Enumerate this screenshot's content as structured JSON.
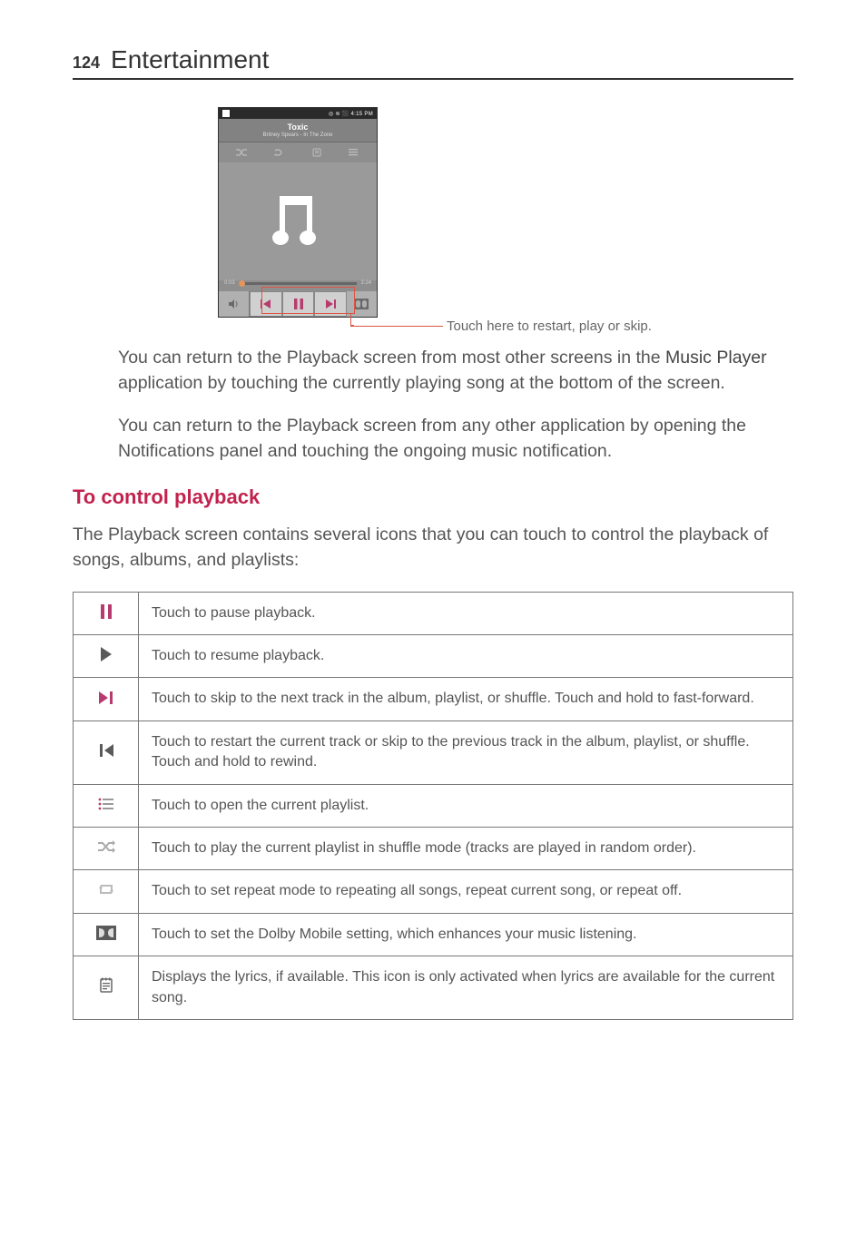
{
  "header": {
    "page_number": "124",
    "section": "Entertainment"
  },
  "screenshot": {
    "status_time": "4:15 PM",
    "song_title": "Toxic",
    "song_subtitle": "Britney Spears - In The Zone",
    "elapsed": "0:03",
    "duration": "3:24"
  },
  "callout": "Touch here to restart, play or skip.",
  "para1_a": "You can return to the Playback screen from most other screens in the ",
  "para1_label": "Music Player",
  "para1_b": " application by touching the currently playing song at the bottom of the screen.",
  "para2": "You can return to the Playback screen from any other application by opening the Notifications panel and touching the ongoing music notification.",
  "subheading": "To control playback",
  "intro": "The Playback screen contains several icons that you can touch to control the playback of songs, albums, and playlists:",
  "rows": [
    {
      "desc": "Touch to pause playback."
    },
    {
      "desc": "Touch to resume playback."
    },
    {
      "desc": "Touch to skip to the next track in the album, playlist, or shuffle. Touch and hold to fast-forward."
    },
    {
      "desc": "Touch to restart the current track or skip to the previous track in the album, playlist, or shuffle. Touch and hold to rewind."
    },
    {
      "desc": "Touch to open the current playlist."
    },
    {
      "desc": "Touch to play the current playlist in shuffle mode (tracks are played in random order)."
    },
    {
      "desc": "Touch to set repeat mode to repeating all songs, repeat current song, or repeat off."
    },
    {
      "desc": "Touch to set the Dolby Mobile setting, which enhances your music listening."
    },
    {
      "desc": "Displays the lyrics, if available. This icon is only activated when lyrics are available for the current song."
    }
  ]
}
